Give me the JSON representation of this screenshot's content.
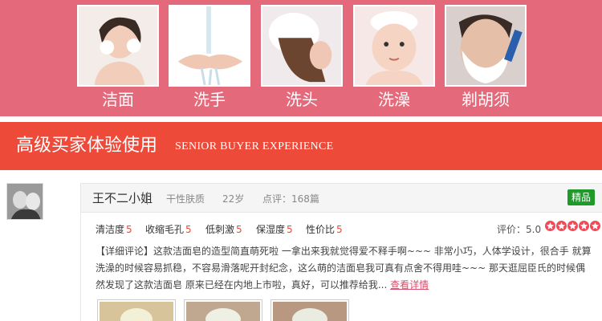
{
  "usage": {
    "items": [
      {
        "label": "洁面"
      },
      {
        "label": "洗手"
      },
      {
        "label": "洗头"
      },
      {
        "label": "洗澡"
      },
      {
        "label": "剃胡须"
      }
    ]
  },
  "banner": {
    "title_cn": "高级买家体验使用",
    "title_en": "SENIOR BUYER EXPERIENCE"
  },
  "review": {
    "username": "王不二小姐",
    "skin_type": "干性肤质",
    "age": "22岁",
    "review_count": "点评：168篇",
    "badge": "精品",
    "ratings": [
      {
        "label": "清洁度",
        "value": "5"
      },
      {
        "label": "收缩毛孔",
        "value": "5"
      },
      {
        "label": "低刺激",
        "value": "5"
      },
      {
        "label": "保湿度",
        "value": "5"
      },
      {
        "label": "性价比",
        "value": "5"
      }
    ],
    "score_label": "评价：5.0",
    "stars": 5,
    "text": "【详细评论】这款洁面皂的造型简直萌死啦 一拿出来我就觉得爱不释手啊~~~ 非常小巧，人体学设计，很合手 就算洗澡的时候容易抓稳，不容易滑落呢开封纪念，这么萌的洁面皂我可真有点舍不得用哇~~~ 那天逛屈臣氏的时候偶然发现了这款洁面皂 原来已经在内地上市啦，真好，可以推荐给我...",
    "more_link": "查看详情"
  },
  "colors": {
    "usage_band": "#e46a7b",
    "title_banner": "#ee4a3a",
    "badge": "#1d9a2a",
    "accent": "#ee4a3a"
  }
}
